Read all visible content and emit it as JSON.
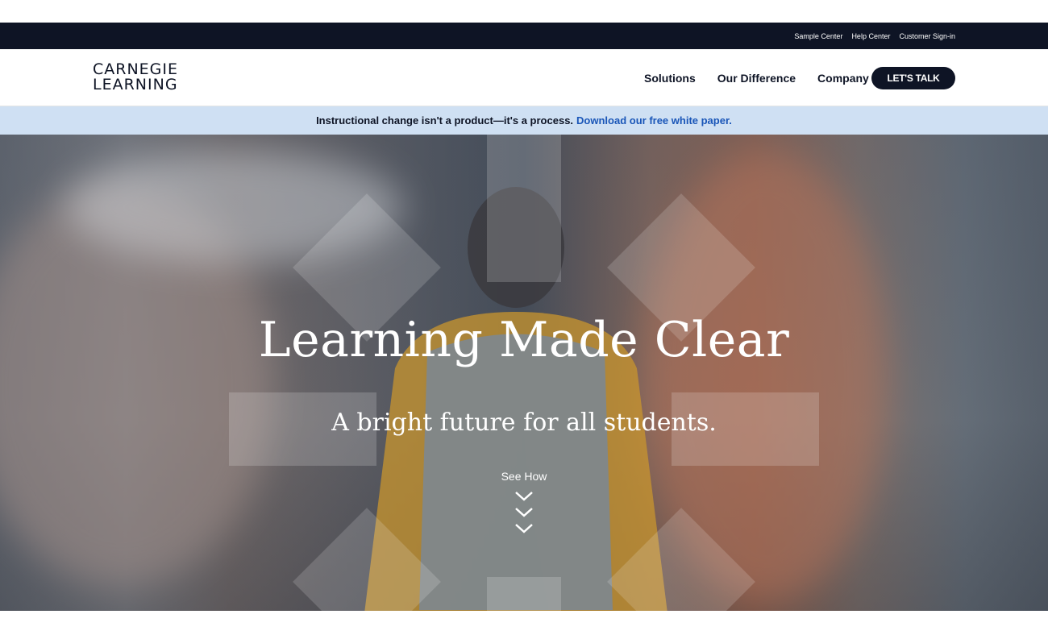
{
  "utility_nav": {
    "links": [
      "Sample Center",
      "Help Center",
      "Customer Sign-in"
    ]
  },
  "header": {
    "logo_line1": "CARNEGIE",
    "logo_line2": "LEARNING",
    "nav": [
      "Solutions",
      "Our Difference",
      "Company"
    ],
    "cta_label": "LET'S TALK"
  },
  "announcement": {
    "text": "Instructional change isn't a product—it's a process.",
    "link_text": "Download our free white paper."
  },
  "hero": {
    "title": "Learning Made Clear",
    "subtitle": "A bright future for all students.",
    "see_how": "See How"
  },
  "colors": {
    "navy": "#0e1425",
    "announcement_bg": "#cfe0f3",
    "link_blue": "#1a56b8"
  }
}
